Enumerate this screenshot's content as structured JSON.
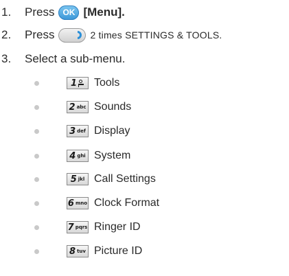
{
  "steps": [
    {
      "number": "1.",
      "text_before": "Press",
      "key_label": "OK",
      "text_after": "[Menu]."
    },
    {
      "number": "2.",
      "text_before": "Press",
      "text_after": "2 times SETTINGS & TOOLS."
    },
    {
      "number": "3.",
      "text": "Select a sub-menu."
    }
  ],
  "submenu": [
    {
      "key_number": "1",
      "key_letters": "",
      "key_icon": "voicemail-icon",
      "label": "Tools"
    },
    {
      "key_number": "2",
      "key_letters": "abc",
      "label": "Sounds"
    },
    {
      "key_number": "3",
      "key_letters": "def",
      "label": "Display"
    },
    {
      "key_number": "4",
      "key_letters": "ghi",
      "label": "System"
    },
    {
      "key_number": "5",
      "key_letters": "jkl",
      "label": "Call Settings"
    },
    {
      "key_number": "6",
      "key_letters": "mno",
      "label": "Clock Format"
    },
    {
      "key_number": "7",
      "key_letters": "pqrs",
      "label": "Ringer ID"
    },
    {
      "key_number": "8",
      "key_letters": "tuv",
      "label": "Picture ID"
    }
  ],
  "colors": {
    "ok_key": "#3b97d8",
    "nav_arrow": "#2b8fd8",
    "bullet": "#c9c9c9",
    "text": "#2a2a2a"
  }
}
